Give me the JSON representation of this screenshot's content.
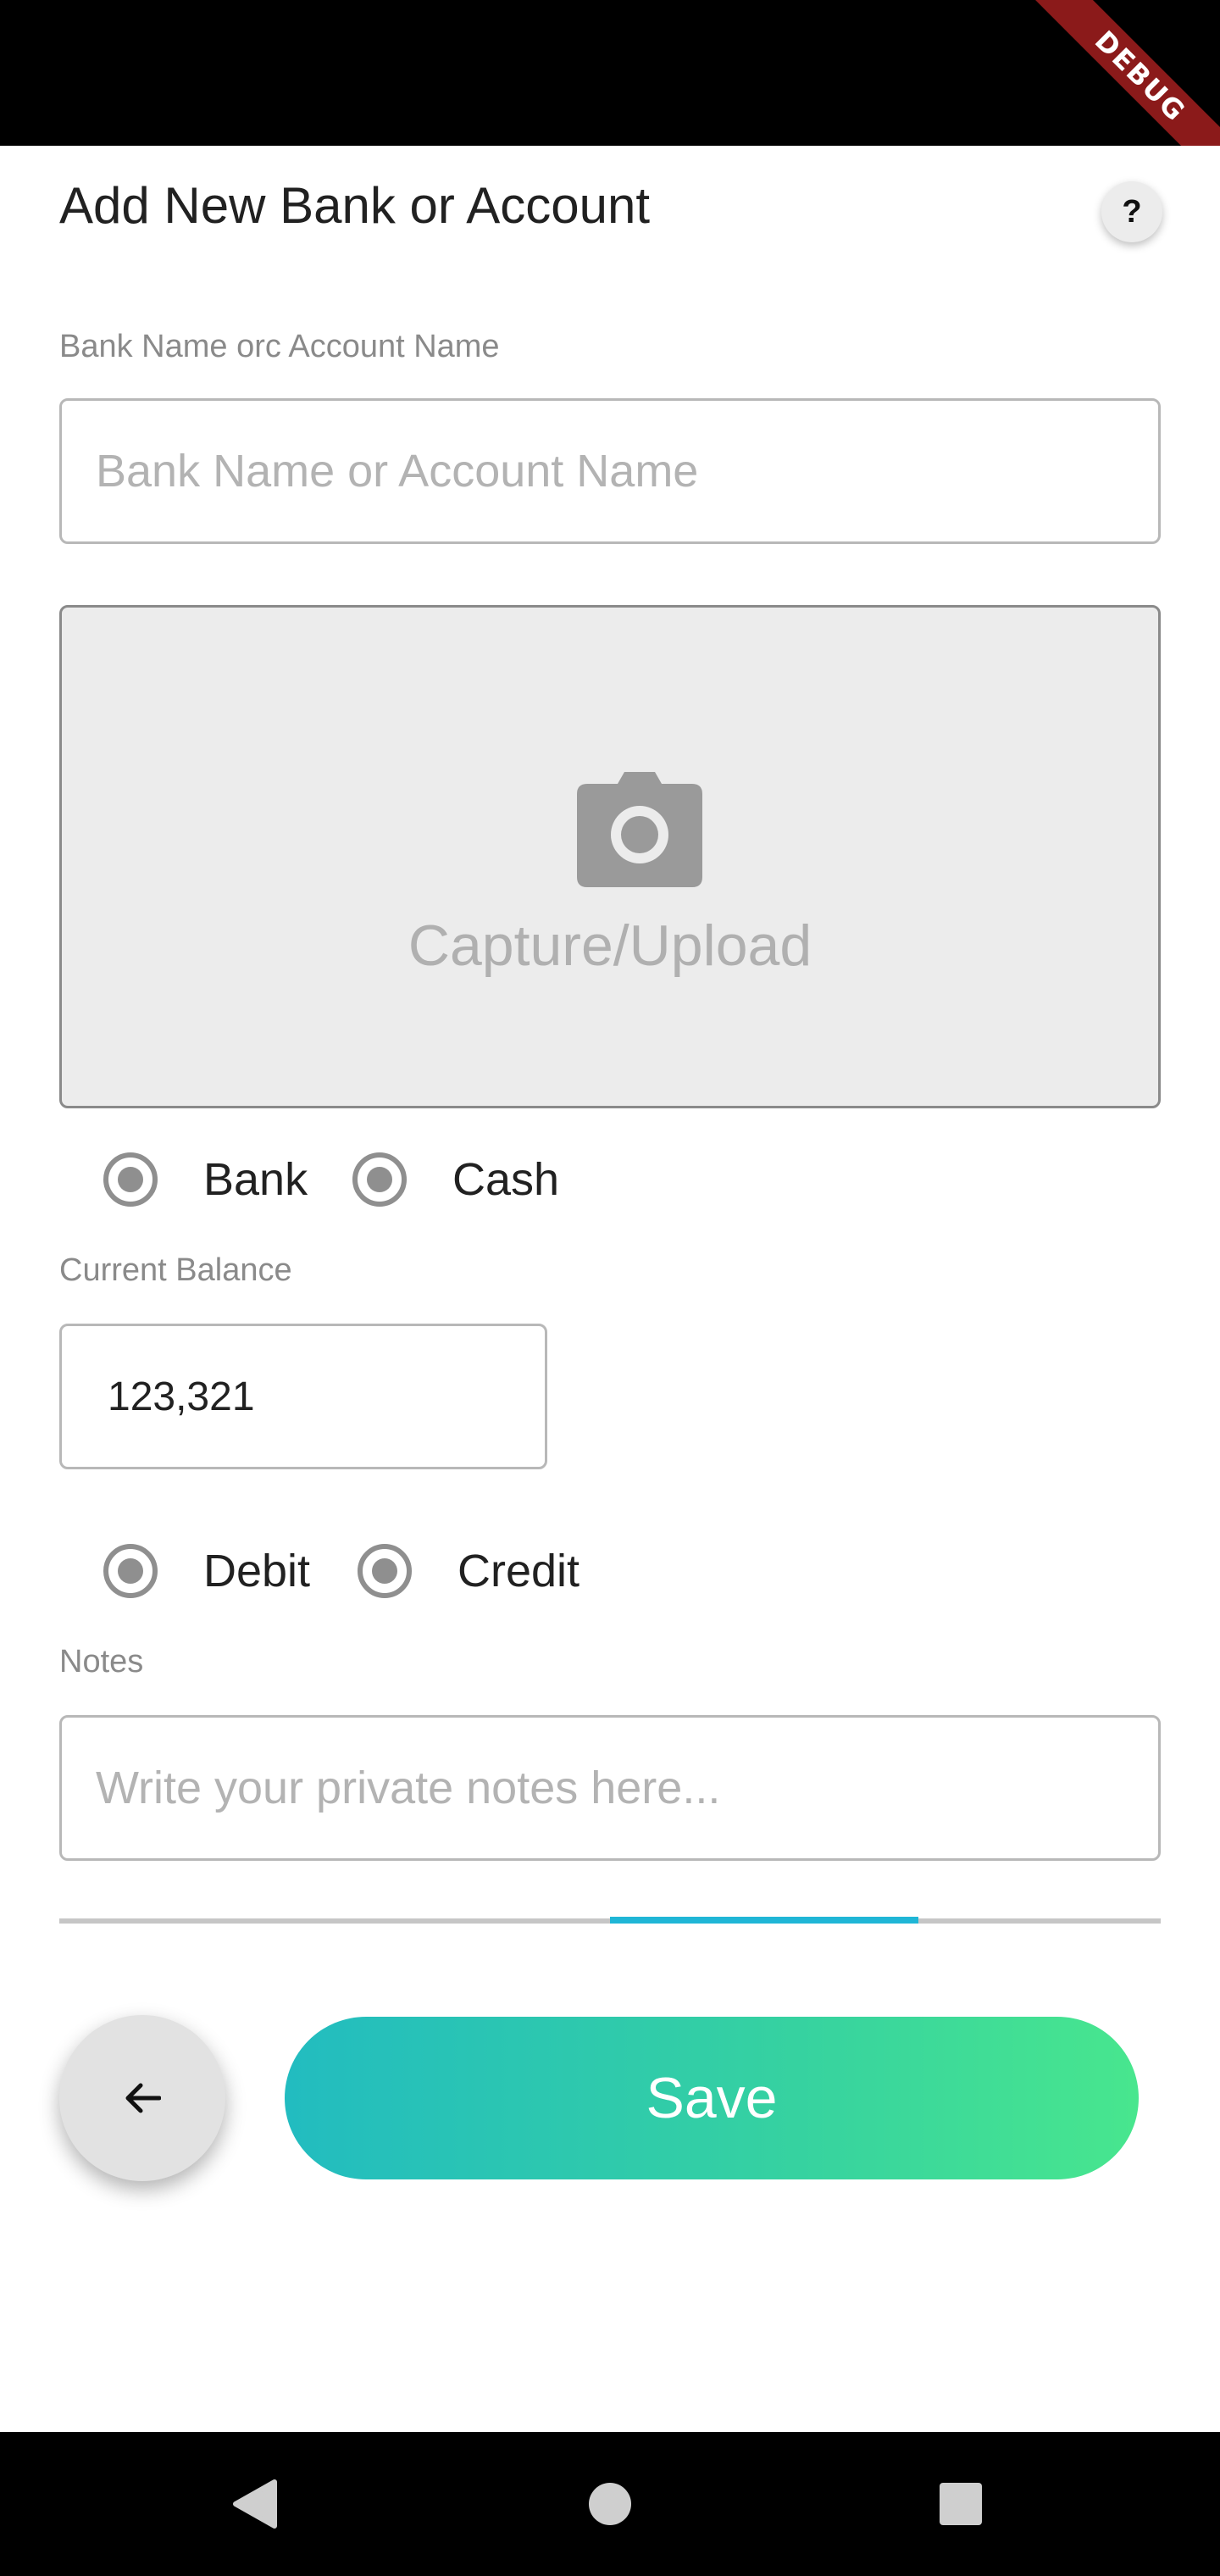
{
  "status_bar": {
    "debug_label": "DEBUG"
  },
  "header": {
    "title": "Add New Bank or Account",
    "help_label": "?"
  },
  "account_name": {
    "label": "Bank Name orc Account Name",
    "placeholder": "Bank Name or Account Name",
    "value": ""
  },
  "upload": {
    "icon": "camera-icon",
    "label": "Capture/Upload"
  },
  "account_type": {
    "options": [
      {
        "label": "Bank",
        "selected": true
      },
      {
        "label": "Cash",
        "selected": true
      }
    ]
  },
  "balance": {
    "label": "Current Balance",
    "value": "123,321"
  },
  "balance_type": {
    "options": [
      {
        "label": "Debit",
        "selected": true
      },
      {
        "label": "Credit",
        "selected": true
      }
    ]
  },
  "notes": {
    "label": "Notes",
    "placeholder": "Write your private notes here...",
    "value": ""
  },
  "progress": {
    "start_fraction": 0.5,
    "end_fraction": 0.78
  },
  "actions": {
    "back_icon": "arrow-left-icon",
    "save_label": "Save"
  },
  "nav": {
    "back_icon": "triangle-back-icon",
    "home_icon": "circle-home-icon",
    "recents_icon": "square-recents-icon"
  },
  "colors": {
    "accent": "#1fb6d6",
    "save_start": "#22bcc0",
    "save_end": "#48e68e",
    "debug": "#8b1a1a"
  }
}
